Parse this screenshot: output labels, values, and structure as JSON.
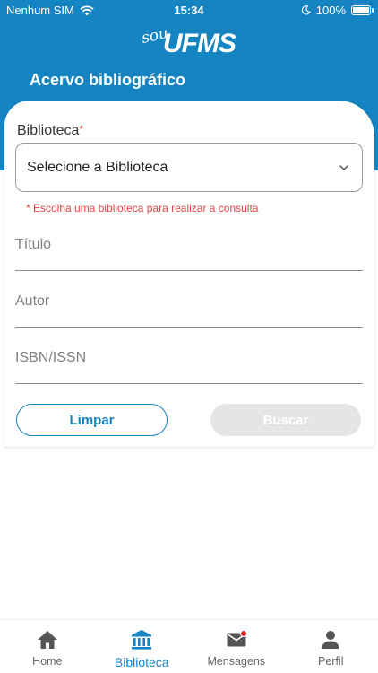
{
  "status_bar": {
    "carrier": "Nenhum SIM",
    "time": "15:34",
    "battery": "100%"
  },
  "logo": {
    "sou": "sou",
    "ufms": "UFMS"
  },
  "header": {
    "title": "Acervo bibliográfico"
  },
  "form": {
    "library_label": "Biblioteca",
    "required_mark": "*",
    "library_select_value": "Selecione a Biblioteca",
    "error_message": "* Escolha uma biblioteca para realizar a consulta",
    "title_placeholder": "Título",
    "author_placeholder": "Autor",
    "isbn_placeholder": "ISBN/ISSN",
    "clear_label": "Limpar",
    "search_label": "Buscar"
  },
  "tabs": [
    {
      "label": "Home",
      "icon": "home-icon"
    },
    {
      "label": "Biblioteca",
      "icon": "library-icon",
      "active": true
    },
    {
      "label": "Mensagens",
      "icon": "mail-icon",
      "badge": true
    },
    {
      "label": "Perfil",
      "icon": "person-icon"
    }
  ],
  "colors": {
    "primary": "#1584c2",
    "error": "#e24646",
    "disabled": "#e5e5e5"
  }
}
